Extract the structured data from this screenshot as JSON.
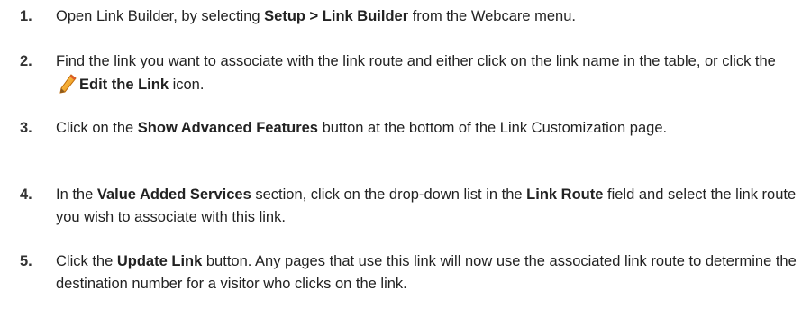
{
  "steps": [
    {
      "number": "1.",
      "text_a": "Open Link Builder, by selecting ",
      "bold_a": "Setup > Link Builder",
      "text_b": " from the Webcare menu."
    },
    {
      "number": "2.",
      "text_a": "Find the link you want to associate with the link route and either click on the link name in the table, or click the ",
      "icon": "edit-pencil-icon",
      "bold_a": "Edit the Link",
      "text_b": " icon."
    },
    {
      "number": "3.",
      "text_a": "Click on the ",
      "bold_a": "Show Advanced Features",
      "text_b": " button at the bottom of the Link Customization page."
    },
    {
      "number": "4.",
      "text_a": "In the ",
      "bold_a": "Value Added Services",
      "text_b": " section, click on the drop-down list in the ",
      "bold_b": "Link Route",
      "text_c": " field and select the link route you wish to associate with this link."
    },
    {
      "number": "5.",
      "text_a": "Click the ",
      "bold_a": "Update Link",
      "text_b": " button. Any pages that use this link will now use the associated link route to determine the destination number for a visitor who clicks on the link."
    }
  ],
  "colors": {
    "text": "#222222",
    "icon_pencil": "#f2a21b"
  }
}
